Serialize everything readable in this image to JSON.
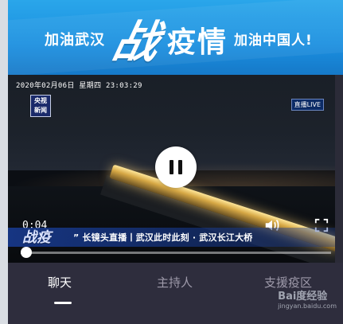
{
  "banner": {
    "left": "加油武汉",
    "big_1": "战",
    "big_2": "疫情",
    "right": "加油中国人!"
  },
  "video": {
    "datetime": "2020年02月06日 星期四 23:03:29",
    "channel_logo_line1": "央视",
    "channel_logo_line2": "新闻",
    "live_badge": "直播LIVE",
    "current_time": "0:04",
    "subtitle_tag": "战疫",
    "subtitle_text": "” 长镜头直播丨武汉此时此刻 · 武汉长江大桥",
    "progress": 0.02
  },
  "tabs": [
    {
      "label": "聊天",
      "active": true
    },
    {
      "label": "主持人",
      "active": false
    },
    {
      "label": "支援疫区",
      "active": false
    }
  ],
  "watermark": {
    "brand": "Bai度经验",
    "url": "jingyan.baidu.com"
  },
  "icons": {
    "pause": "pause-icon",
    "volume": "volume-icon",
    "fullscreen": "fullscreen-icon"
  }
}
